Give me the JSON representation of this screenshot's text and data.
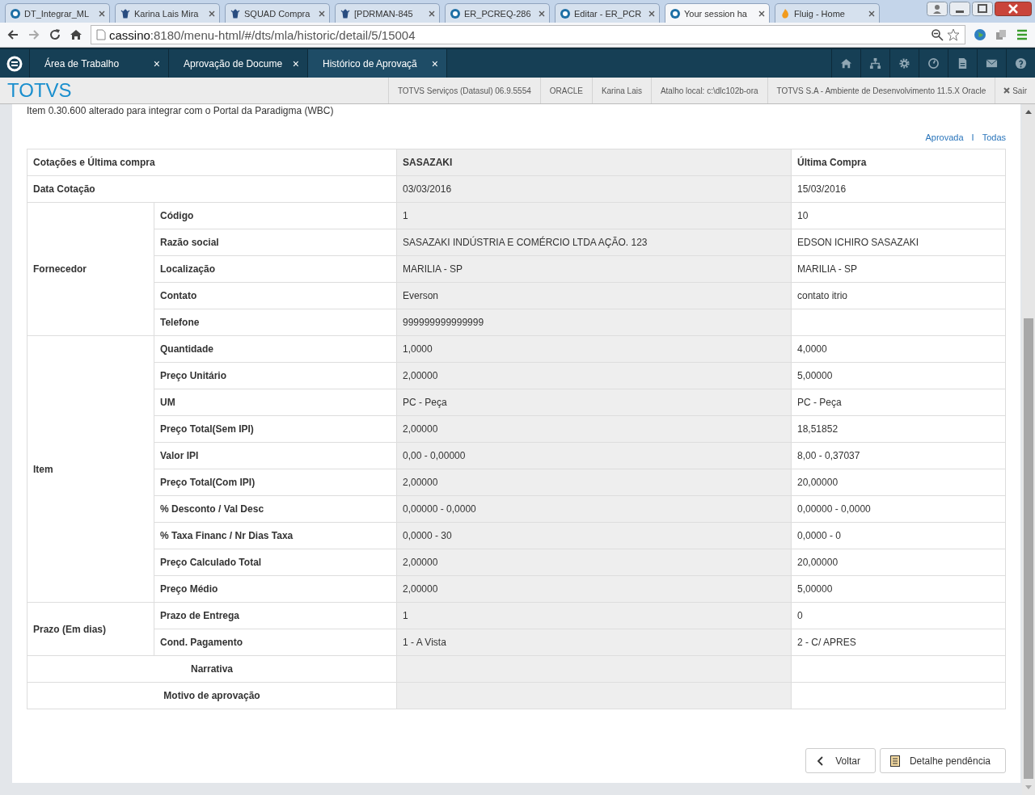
{
  "browser_tabs": [
    {
      "title": "DT_Integrar_ML",
      "selected": false
    },
    {
      "title": "Karina Lais Mira",
      "selected": false
    },
    {
      "title": "SQUAD Compra",
      "selected": false
    },
    {
      "title": "[PDRMAN-845",
      "selected": false
    },
    {
      "title": "ER_PCREQ-286",
      "selected": false
    },
    {
      "title": "Editar - ER_PCR",
      "selected": false
    },
    {
      "title": "Your session ha",
      "selected": true
    },
    {
      "title": "Fluig - Home",
      "selected": false
    }
  ],
  "address": {
    "host": "cassino",
    "path": ":8180/menu-html/#/dts/mla/historic/detail/5/15004"
  },
  "app_tabs": [
    {
      "label": "Área de Trabalho",
      "close": "×",
      "selected": false
    },
    {
      "label": "Aprovação de Docume",
      "close": "×",
      "selected": false
    },
    {
      "label": "Histórico de Aprovaçã",
      "close": "×",
      "selected": true
    }
  ],
  "brand": "TOTVS",
  "info_items": [
    "TOTVS Serviços (Datasul) 06.9.5554",
    "ORACLE",
    "Karina Lais",
    "Atalho local: c:\\dlc102b-ora",
    "TOTVS S.A - Ambiente de Desenvolvimento 11.5.X Oracle"
  ],
  "logout": "Sair",
  "intro": "Item 0.30.600 alterado para integrar com o Portal da Paradigma (WBC)",
  "filters": [
    {
      "label": "Aprovada"
    },
    {
      "label": "Todas"
    }
  ],
  "filter_separator": "I",
  "table": {
    "columns": [
      "Cotações e Última compra",
      "SASAZAKI",
      "Última Compra"
    ],
    "rows": [
      {
        "kind": "full",
        "label": "Data Cotação",
        "values": [
          "03/03/2016",
          "15/03/2016"
        ]
      },
      {
        "kind": "group",
        "label": "Fornecedor",
        "rows": [
          {
            "label": "Código",
            "values": [
              "1",
              "10"
            ]
          },
          {
            "label": "Razão social",
            "values": [
              "SASAZAKI INDÚSTRIA E COMÉRCIO LTDA AÇÃO. 123",
              "EDSON ICHIRO SASAZAKI"
            ]
          },
          {
            "label": "Localização",
            "values": [
              "MARILIA - SP",
              "MARILIA - SP"
            ]
          },
          {
            "label": "Contato",
            "values": [
              "Everson",
              "contato itrio"
            ]
          },
          {
            "label": "Telefone",
            "values": [
              "999999999999999"
            ]
          }
        ]
      },
      {
        "kind": "group",
        "label": "Item",
        "rows": [
          {
            "label": "Quantidade",
            "values": [
              "1,0000",
              "4,0000"
            ]
          },
          {
            "label": "Preço Unitário",
            "values": [
              "2,00000",
              "5,00000"
            ]
          },
          {
            "label": "UM",
            "values": [
              "PC - Peça",
              "PC - Peça"
            ]
          },
          {
            "label": "Preço Total(Sem IPI)",
            "values": [
              "2,00000",
              "18,51852"
            ]
          },
          {
            "label": "Valor IPI",
            "values": [
              "0,00 - 0,00000",
              "8,00 - 0,37037"
            ]
          },
          {
            "label": "Preço Total(Com IPI)",
            "values": [
              "2,00000",
              "20,00000"
            ]
          },
          {
            "label": "% Desconto / Val Desc",
            "values": [
              "0,00000 - 0,0000",
              "0,00000 - 0,0000"
            ]
          },
          {
            "label": "% Taxa Financ / Nr Dias Taxa",
            "values": [
              "0,0000 - 30",
              "0,0000 - 0"
            ]
          },
          {
            "label": "Preço Calculado Total",
            "values": [
              "2,00000",
              "20,00000"
            ]
          },
          {
            "label": "Preço Médio",
            "values": [
              "2,00000",
              "5,00000"
            ]
          }
        ]
      },
      {
        "kind": "group",
        "label": "Prazo (Em dias)",
        "rows": [
          {
            "label": "Prazo de Entrega",
            "values": [
              "1",
              "0"
            ]
          },
          {
            "label": "Cond. Pagamento",
            "values": [
              "1 - A Vista",
              "2 - C/ APRES"
            ]
          }
        ]
      },
      {
        "kind": "note",
        "label": "Narrativa"
      },
      {
        "kind": "note",
        "label": "Motivo de aprovação"
      }
    ]
  },
  "buttons": [
    {
      "label": "Voltar"
    },
    {
      "label": "Detalhe pendência"
    }
  ]
}
